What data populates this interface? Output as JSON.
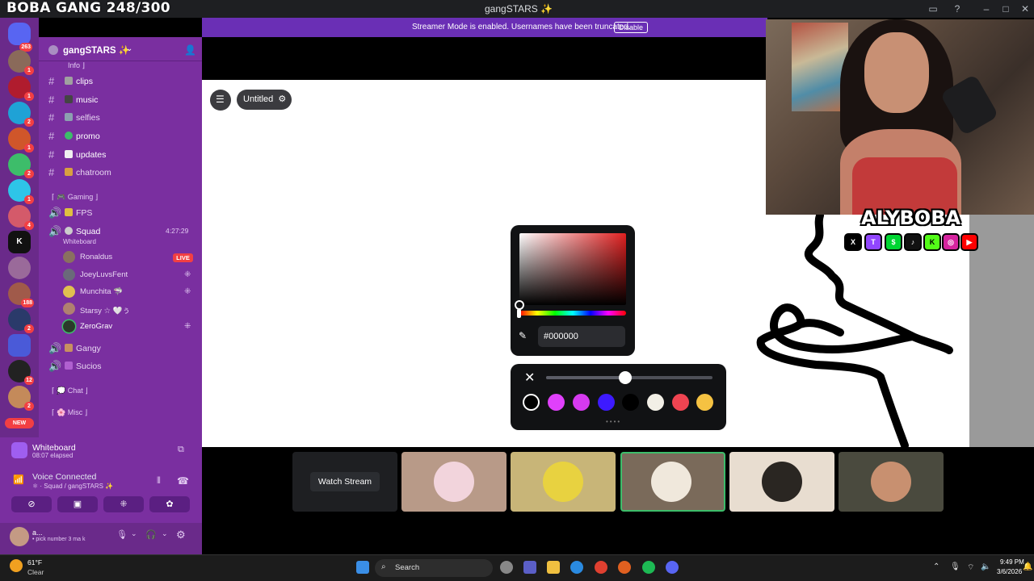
{
  "overlay": {
    "title": "BOBA GANG 248/300"
  },
  "window": {
    "title": "gangSTARS ✨"
  },
  "banner": {
    "text": "Streamer Mode is enabled. Usernames have been truncated.",
    "disable_label": "Disable"
  },
  "rail": {
    "home_badge": "263",
    "badges": [
      "1",
      "1",
      "2",
      "1",
      "2",
      "1",
      "4",
      "188",
      "2",
      "12",
      "2"
    ],
    "new_label": "NEW"
  },
  "server": {
    "name": "gangSTARS ✨"
  },
  "channels": {
    "info_category": "Info ⌋",
    "clips": "clips",
    "music": "music",
    "selfies": "selfies",
    "promo": "promo",
    "updates": "updates",
    "chatroom": "chatroom",
    "gaming_category": "⌈ 🎮 Gaming ⌋",
    "fps": "FPS",
    "squad": "Squad",
    "squad_activity": "Whiteboard",
    "squad_time": "4:27:29",
    "gangy": "Gangy",
    "sucios": "Sucios",
    "chat_category": "⌈ 💭 Chat ⌋",
    "misc_category": "⌈ 🌸 Misc ⌋"
  },
  "voice_users": [
    {
      "name": "Ronaldus",
      "live": "LIVE"
    },
    {
      "name": "JoeyLuvsFent"
    },
    {
      "name": "Munchita 🦈"
    },
    {
      "name": "Starsy ☆ 🤍ぅ"
    },
    {
      "name": "ZeroGrav"
    }
  ],
  "activity_panel": {
    "title": "Whiteboard",
    "elapsed": "08:07 elapsed"
  },
  "voice_panel": {
    "title": "Voice Connected",
    "subtitle": "⚛ · Squad / gangSTARS ✨"
  },
  "user_panel": {
    "name": "a...",
    "status": "• pick number 3 ma k"
  },
  "whiteboard": {
    "doc_name": "Untitled",
    "hex_value": "#000000",
    "swatch_colors": [
      "#000000",
      "#e040fb",
      "#d63af0",
      "#3d1aff",
      "#000000",
      "#f2efe6",
      "#ef4451",
      "#f5c242"
    ],
    "stroke_size_percent": 45
  },
  "stream_strip": {
    "watch_label": "Watch Stream"
  },
  "branding": {
    "name": "ALYBOBA",
    "socials": [
      "X",
      "T",
      "$",
      "♪",
      "K",
      "◎",
      "▶"
    ]
  },
  "taskbar": {
    "temp": "61°F",
    "weather": "Clear",
    "search_placeholder": "Search",
    "time": "9:49 PM",
    "date": "3/6/2026"
  },
  "colors": {
    "accent": "#7a2fa0",
    "blurple": "#5865f2",
    "live_red": "#f23f43"
  }
}
